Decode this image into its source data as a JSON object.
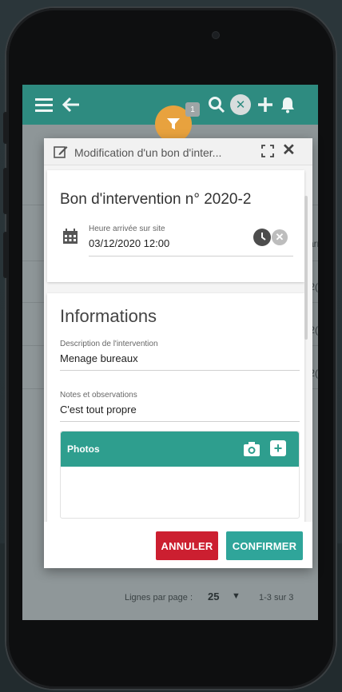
{
  "topbar": {
    "menu_icon": "hamburger-icon",
    "back_icon": "arrow-left-icon",
    "filter_icon": "filter-icon",
    "filter_badge": "1",
    "search_icon": "search-icon",
    "tools_icon": "tools-icon",
    "add_icon": "plus-icon",
    "bell_icon": "bell-icon",
    "color": "#2e8b80",
    "filter_color": "#e8a23e"
  },
  "background_list": {
    "header_fragment": "arr",
    "row_fragments": [
      "/2(",
      "/2(",
      "/2("
    ]
  },
  "footer": {
    "rows_label": "Lignes par page :",
    "rows_value": "25",
    "range": "1-3 sur 3"
  },
  "modal": {
    "title": "Modification d'un bon d'inter...",
    "card": {
      "title": "Bon d'intervention n° 2020-2",
      "arrival_label": "Heure arrivée sur site",
      "arrival_value": "03/12/2020 12:00"
    },
    "info": {
      "section_title": "Informations",
      "description_label": "Description de l'intervention",
      "description_value": "Menage bureaux",
      "notes_label": "Notes et observations",
      "notes_value": "C'est tout propre",
      "photos_label": "Photos"
    },
    "buttons": {
      "cancel": "ANNULER",
      "confirm": "CONFIRMER",
      "cancel_color": "#cc1f30",
      "confirm_color": "#2fa59a"
    }
  }
}
